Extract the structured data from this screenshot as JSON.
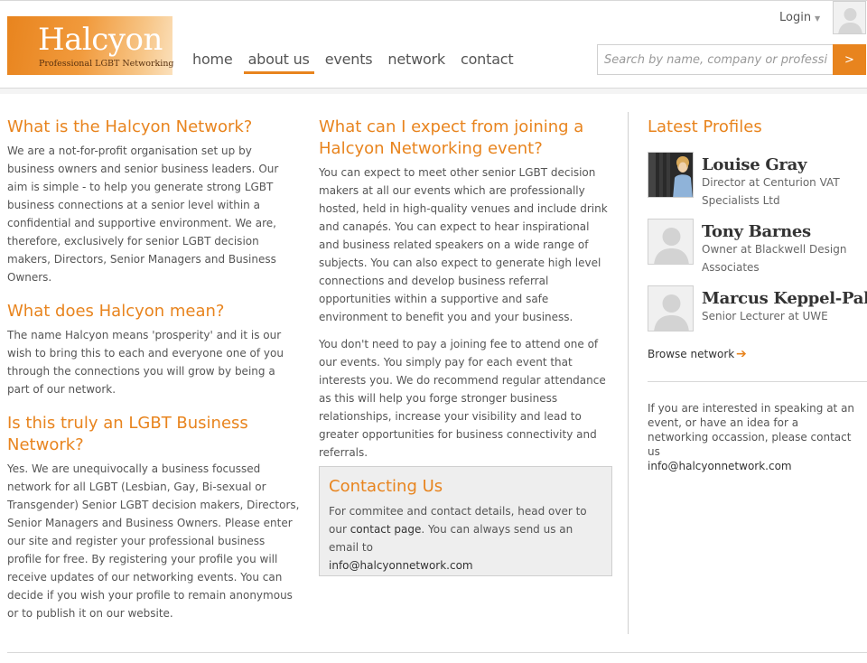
{
  "brand": {
    "title": "Halcyon",
    "subtitle": "Professional LGBT Networking",
    "accent": "#e8841e"
  },
  "nav": {
    "items": [
      {
        "label": "home"
      },
      {
        "label": "about us",
        "active": true
      },
      {
        "label": "events"
      },
      {
        "label": "network"
      },
      {
        "label": "contact"
      }
    ]
  },
  "account": {
    "login_label": "Login",
    "caret_icon": "caret-down-icon",
    "avatar_icon": "user-silhouette-icon"
  },
  "search": {
    "placeholder": "Search by name, company or profession",
    "button_label": ">"
  },
  "col1": {
    "sections": [
      {
        "heading": "What is the Halcyon Network?",
        "body": "We are a not-for-profit organisation set up by business owners and senior business leaders. Our aim is simple - to help you generate strong LGBT business connections at a senior level within a confidential and supportive environment. We are, therefore, exclusively for senior LGBT decision makers, Directors, Senior Managers and Business Owners."
      },
      {
        "heading": "What does Halcyon mean?",
        "body": "The name Halcyon means 'prosperity' and it is our wish to bring this to each and everyone one of you through the connections you will grow by being a part of our network."
      },
      {
        "heading": "Is this truly an LGBT Business Network?",
        "body": "Yes. We are unequivocally a business focussed network for all LGBT (Lesbian, Gay, Bi-sexual or Transgender) Senior LGBT decision makers, Directors, Senior Managers and Business Owners. Please enter our site and register your professional business profile for free. By registering your profile you will receive updates of our networking events. You can decide if you wish your profile to remain anonymous or to publish it on our website."
      }
    ]
  },
  "col2": {
    "heading": "What can I expect from joining a Halcyon Networking event?",
    "para1": "You can expect to meet other senior LGBT decision makers at all our events which are professionally hosted, held in high-quality venues and include drink and canapés. You can expect to hear inspirational and business related speakers on a wide range of subjects. You can also expect to generate high level connections and develop business referral opportunities within a supportive and safe environment to benefit you and your business.",
    "para2": "You don't need to pay a joining fee to attend one of our events. You simply pay for each event that interests you. We do recommend regular attendance as this will help you forge stronger business relationships, increase your visibility and lead to greater opportunities for business connectivity and referrals."
  },
  "contact_box": {
    "heading": "Contacting Us",
    "text_before": "For commitee and contact details, head over to our ",
    "link_label": "contact page",
    "text_after": ". You can always send us an email to",
    "email": "info@halcyonnetwork.com"
  },
  "sidebar": {
    "heading": "Latest Profiles",
    "profiles": [
      {
        "name": "Louise Gray",
        "role": "Director at Centurion VAT Specialists Ltd",
        "photo": "photo"
      },
      {
        "name": "Tony Barnes",
        "role": "Owner at Blackwell Design Associates",
        "photo": "placeholder-avatar-icon"
      },
      {
        "name": "Marcus Keppel-Palmer",
        "role": "Senior Lecturer at UWE",
        "photo": "placeholder-avatar-icon"
      }
    ],
    "browse_label": "Browse network",
    "browse_icon": "arrow-right-icon",
    "speak_text": "If you are interested in speaking at an event, or have an idea for a networking occassion, please contact us",
    "email": "info@halcyonnetwork.com"
  }
}
